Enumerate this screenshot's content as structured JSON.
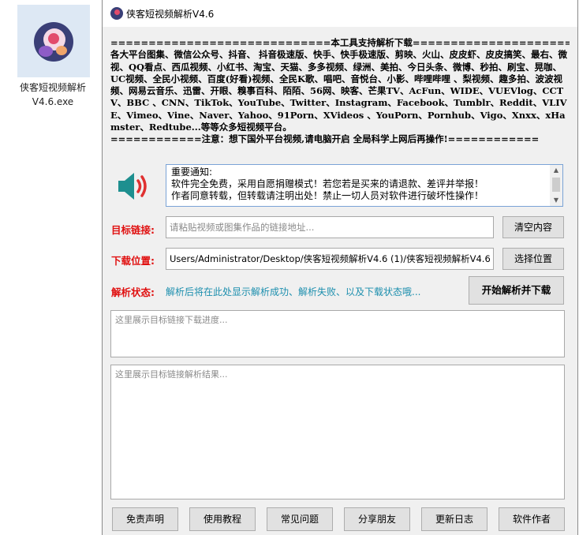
{
  "desktop_icon": {
    "label_line1": "侠客短视频解析",
    "label_line2": "V4.6.exe"
  },
  "window": {
    "title": "侠客短视频解析V4.6"
  },
  "support": {
    "header": "=============================本工具支持解析下载=============================",
    "body": "各大平台图集、微信公众号、抖音、 抖音极速版、快手、快手极速版、剪映、火山、皮皮虾、皮皮搞笑、最右、微视、QQ看点、西瓜视频、小红书、淘宝、天猫、多多视频、绿洲、美拍、今日头条、微博、秒拍、刷宝、晃咖、UC视频、全民小视频、百度(好看)视频、全民K歌、唱吧、音悦台、小影、哔哩哔哩 、梨视频、趣多拍、波波视频、网易云音乐、迅雷、开眼、糗事百科、陌陌、56网、映客、芒果TV、AcFun、WIDE、VUEVlog、CCTV、BBC 、CNN、TikTok、YouTube、Twitter、Instagram、Facebook、Tumblr、Reddit、VLIVE、Vimeo、Vine、Naver、Yahoo、91Porn、XVideos 、YouPorn、Pornhub、Vigo、Xnxx、xHamster、Redtube...等等众多短视频平台。",
    "footer": "============注意：想下国外平台视频,请电脑开启 全局科学上网后再操作!============"
  },
  "notice": {
    "line1": "重要通知:",
    "line2": "软件完全免费，采用自愿捐赠模式！若您若是买来的请退款、差评并举报！",
    "line3": "作者同意转载，但转载请注明出处！禁止一切人员对软件进行破坏性操作！"
  },
  "target_link": {
    "label": "目标链接:",
    "placeholder": "请粘贴视频或图集作品的链接地址...",
    "clear_button": "清空内容"
  },
  "download_location": {
    "label": "下载位置:",
    "value": "Users/Administrator/Desktop/侠客短视频解析V4.6 (1)/侠客短视频解析V4.6",
    "select_button": "选择位置"
  },
  "parse_status": {
    "label": "解析状态:",
    "text": "解析后将在此处显示解析成功、解析失败、以及下载状态哦...",
    "start_button": "开始解析并下载"
  },
  "progress_area": {
    "placeholder": "这里展示目标链接下载进度..."
  },
  "result_area": {
    "placeholder": "这里展示目标链接解析结果..."
  },
  "bottom_buttons": [
    "免责声明",
    "使用教程",
    "常见问题",
    "分享朋友",
    "更新日志",
    "软件作者"
  ],
  "colors": {
    "label_red": "#e01010",
    "status_teal": "#1d8fae",
    "speaker_teal": "#1e8f8f",
    "speaker_red": "#e03030"
  }
}
